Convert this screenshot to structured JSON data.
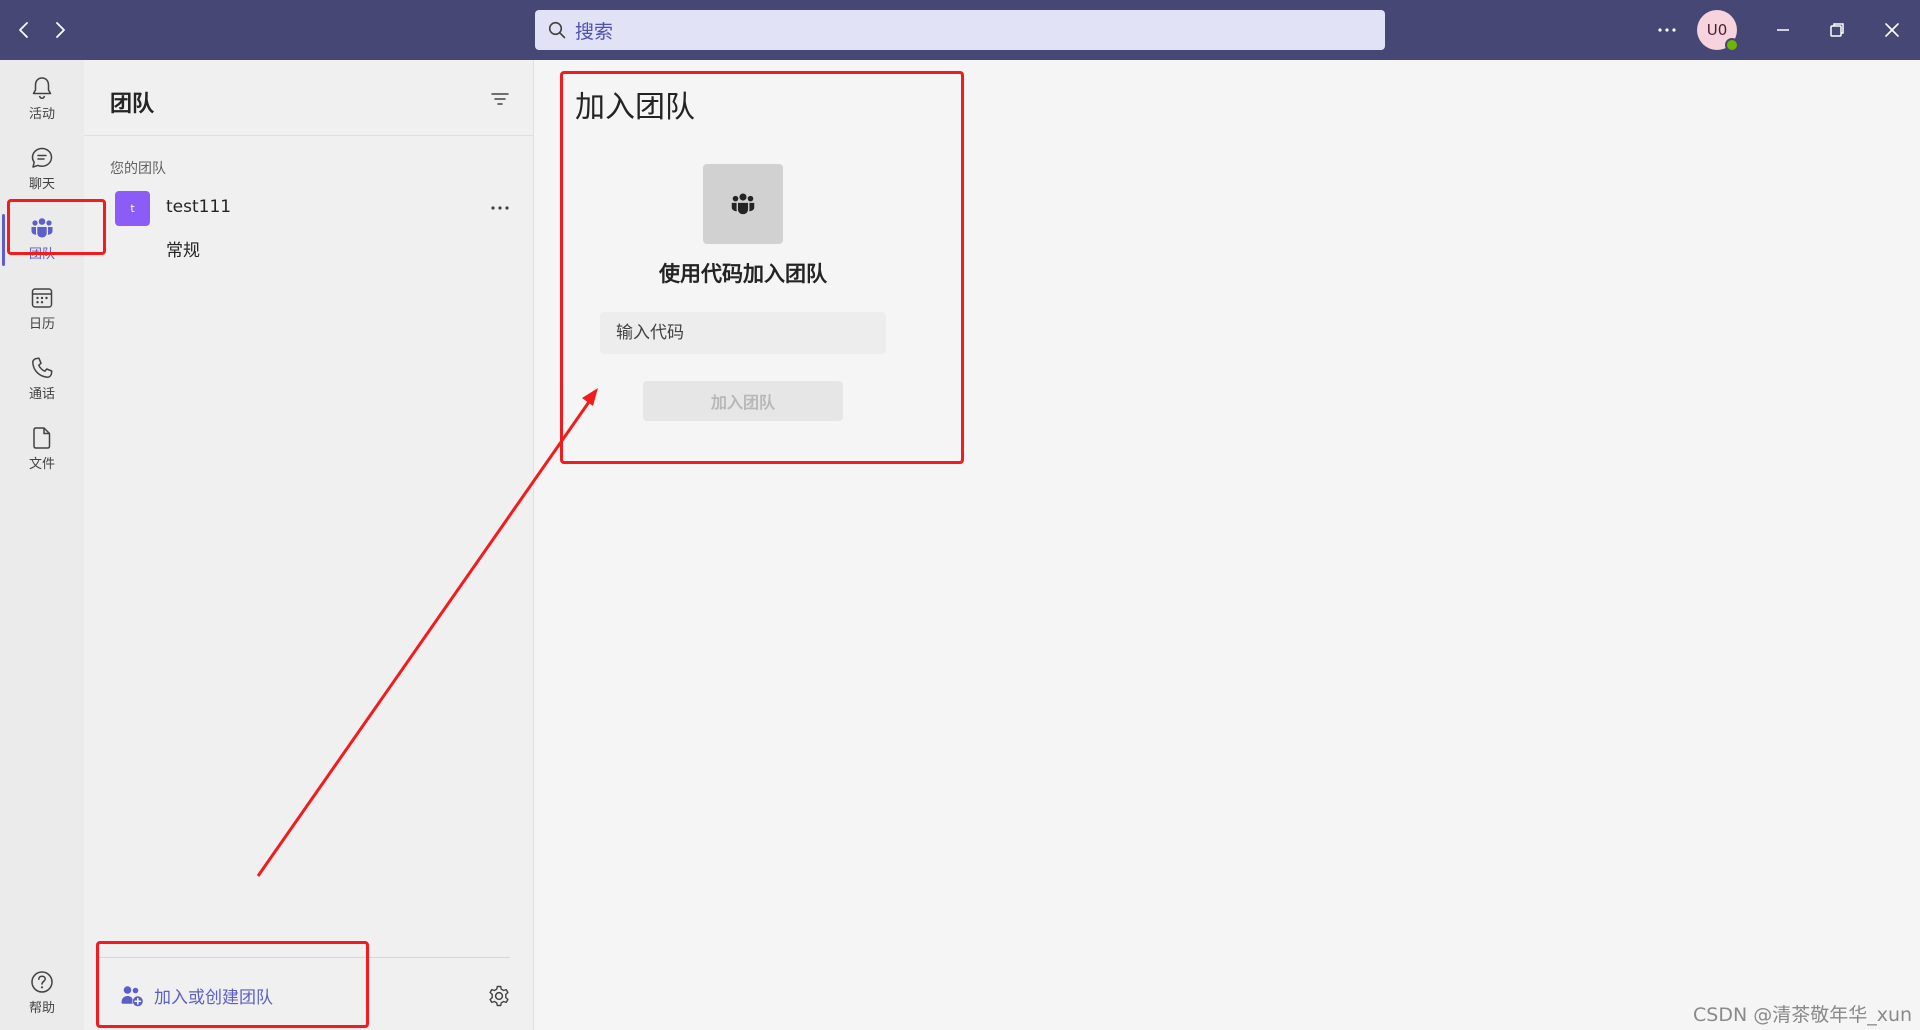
{
  "titlebar": {
    "search_placeholder": "搜索",
    "avatar_initials": "U0"
  },
  "rail": {
    "items": [
      {
        "label": "活动",
        "icon": "bell-icon"
      },
      {
        "label": "聊天",
        "icon": "chat-icon"
      },
      {
        "label": "团队",
        "icon": "teams-icon",
        "active": true
      },
      {
        "label": "日历",
        "icon": "calendar-icon"
      },
      {
        "label": "通话",
        "icon": "phone-icon"
      },
      {
        "label": "文件",
        "icon": "file-icon"
      }
    ],
    "help_label": "帮助"
  },
  "panel": {
    "title": "团队",
    "section_label": "您的团队",
    "teams": [
      {
        "avatar_letter": "t",
        "name": "test111",
        "channels": [
          "常规"
        ]
      }
    ],
    "join_create_label": "加入或创建团队"
  },
  "main": {
    "title": "加入团队",
    "card_heading": "使用代码加入团队",
    "code_placeholder": "输入代码",
    "join_button_label": "加入团队"
  },
  "colors": {
    "titlebar": "#464775",
    "accent": "#5b5fc7",
    "annotation": "#f21c1c"
  },
  "watermark": "CSDN @清茶敬年华_xun"
}
